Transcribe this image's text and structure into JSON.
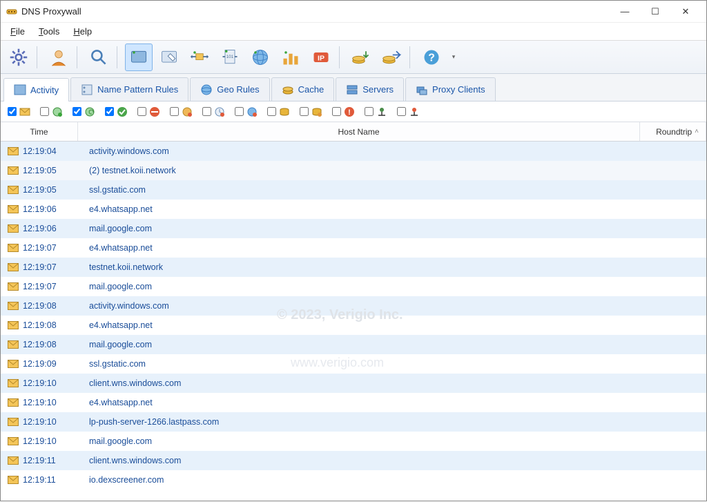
{
  "window": {
    "title": "DNS Proxywall"
  },
  "menu": {
    "file": "File",
    "tools": "Tools",
    "help": "Help"
  },
  "tabs": {
    "activity": "Activity",
    "rules": "Name Pattern Rules",
    "geo": "Geo Rules",
    "cache": "Cache",
    "servers": "Servers",
    "clients": "Proxy Clients"
  },
  "columns": {
    "time": "Time",
    "host": "Host Name",
    "rt": "Roundtrip"
  },
  "watermark": {
    "line1": "© 2023, Verigio Inc.",
    "line2": "www.verigio.com"
  },
  "filters": [
    {
      "name": "mail",
      "checked": true
    },
    {
      "name": "allow",
      "checked": false
    },
    {
      "name": "refresh",
      "checked": true
    },
    {
      "name": "verified",
      "checked": true
    },
    {
      "name": "block",
      "checked": false
    },
    {
      "name": "warn",
      "checked": false
    },
    {
      "name": "time",
      "checked": false
    },
    {
      "name": "globe",
      "checked": false
    },
    {
      "name": "db",
      "checked": false
    },
    {
      "name": "dbwarn",
      "checked": false
    },
    {
      "name": "alert",
      "checked": false
    },
    {
      "name": "netup",
      "checked": false
    },
    {
      "name": "netalert",
      "checked": false
    }
  ],
  "rows": [
    {
      "time": "12:19:04",
      "host": "activity.windows.com"
    },
    {
      "time": "12:19:05",
      "host": " (2) testnet.koii.network",
      "selected": true
    },
    {
      "time": "12:19:05",
      "host": "ssl.gstatic.com"
    },
    {
      "time": "12:19:06",
      "host": "e4.whatsapp.net"
    },
    {
      "time": "12:19:06",
      "host": "mail.google.com"
    },
    {
      "time": "12:19:07",
      "host": "e4.whatsapp.net"
    },
    {
      "time": "12:19:07",
      "host": "testnet.koii.network"
    },
    {
      "time": "12:19:07",
      "host": "mail.google.com"
    },
    {
      "time": "12:19:08",
      "host": "activity.windows.com"
    },
    {
      "time": "12:19:08",
      "host": "e4.whatsapp.net"
    },
    {
      "time": "12:19:08",
      "host": "mail.google.com"
    },
    {
      "time": "12:19:09",
      "host": "ssl.gstatic.com"
    },
    {
      "time": "12:19:10",
      "host": "client.wns.windows.com"
    },
    {
      "time": "12:19:10",
      "host": "e4.whatsapp.net"
    },
    {
      "time": "12:19:10",
      "host": "lp-push-server-1266.lastpass.com"
    },
    {
      "time": "12:19:10",
      "host": "mail.google.com"
    },
    {
      "time": "12:19:11",
      "host": "client.wns.windows.com"
    },
    {
      "time": "12:19:11",
      "host": "io.dexscreener.com"
    }
  ]
}
